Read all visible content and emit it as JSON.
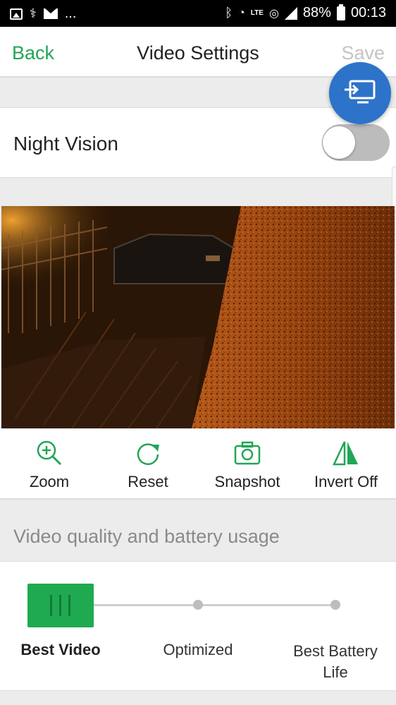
{
  "status_bar": {
    "more": "...",
    "battery_pct": "88%",
    "time": "00:13",
    "lte": "LTE"
  },
  "header": {
    "back_label": "Back",
    "title": "Video Settings",
    "save_label": "Save"
  },
  "night_vision": {
    "label": "Night Vision",
    "enabled": false
  },
  "actions": [
    {
      "label": "Zoom",
      "icon": "zoom-in-icon"
    },
    {
      "label": "Reset",
      "icon": "reset-icon"
    },
    {
      "label": "Snapshot",
      "icon": "camera-icon"
    },
    {
      "label": "Invert Off",
      "icon": "invert-icon"
    }
  ],
  "quality": {
    "section_title": "Video quality and battery usage",
    "options": [
      "Best Video",
      "Optimized",
      "Best Battery Life"
    ],
    "best_battery_line1": "Best Battery",
    "best_battery_line2": "Life",
    "selected": "Best Video"
  },
  "colors": {
    "accent_green": "#21a656",
    "fab_blue": "#2d73c9",
    "slider_green": "#1faa51"
  }
}
